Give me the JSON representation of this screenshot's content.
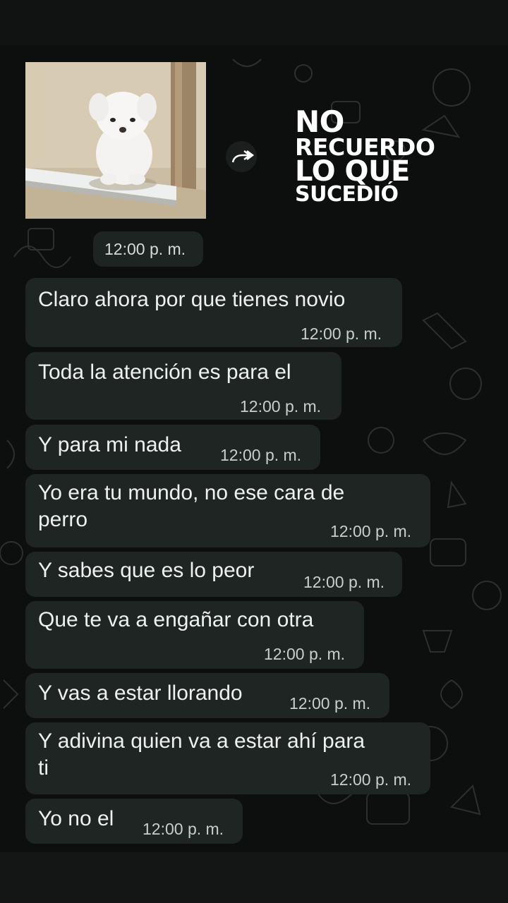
{
  "sticker": {
    "forward_icon": "forward-arrow-icon",
    "caption_lines": [
      "NO",
      "RECUERDO",
      "LO QUE",
      "SUCEDIÓ"
    ],
    "time": "12:00 p. m."
  },
  "messages": [
    {
      "text": "Claro ahora por que tienes novio",
      "time": "12:00 p. m."
    },
    {
      "text": "Toda la atención es para el",
      "time": "12:00 p. m."
    },
    {
      "text": "Y para mi nada",
      "time": "12:00 p. m."
    },
    {
      "text": "Yo era tu mundo, no ese cara de\nperro",
      "time": "12:00 p. m."
    },
    {
      "text": "Y sabes que es lo peor",
      "time": "12:00 p. m."
    },
    {
      "text": "Que te va a engañar con otra",
      "time": "12:00 p. m."
    },
    {
      "text": "Y vas a estar llorando",
      "time": "12:00 p. m."
    },
    {
      "text": "Y adivina quien va a estar ahí para\nti",
      "time": "12:00 p. m."
    },
    {
      "text": "Yo no el",
      "time": "12:00 p. m."
    }
  ],
  "colors": {
    "background": "#0d0f0e",
    "bubble": "#1f2523",
    "text": "#eef1ef",
    "timestamp": "#c9cecb"
  }
}
